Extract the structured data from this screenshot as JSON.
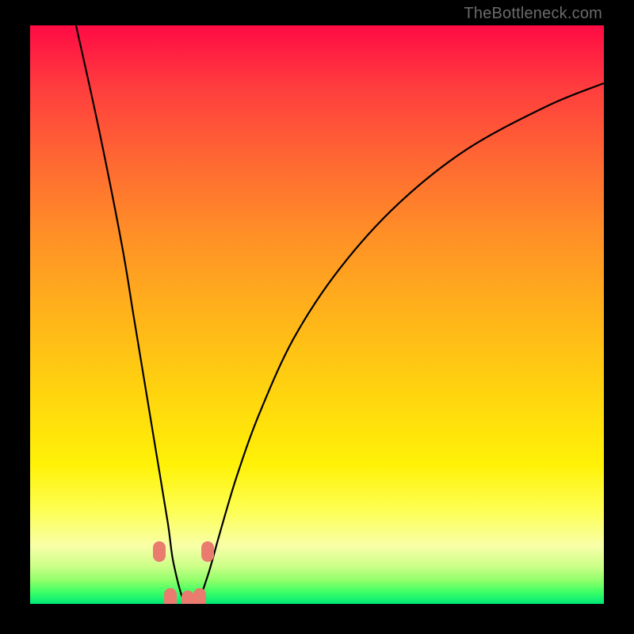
{
  "watermark": "TheBottleneck.com",
  "colors": {
    "frame": "#000000",
    "curve": "#000000",
    "marker": "#ea7c6f",
    "watermark": "#6a6a6a"
  },
  "chart_data": {
    "type": "line",
    "title": "",
    "xlabel": "",
    "ylabel": "",
    "xlim": [
      0,
      100
    ],
    "ylim": [
      0,
      100
    ],
    "grid": false,
    "legend": false,
    "notes": "Bottleneck-style curve: minimum (~0) near x≈27; rises steeply on both sides. Background is a vertical red→green gradient.",
    "series": [
      {
        "name": "bottleneck-curve",
        "x": [
          8,
          12,
          16,
          18,
          20,
          22,
          24,
          25,
          27,
          29,
          31,
          33,
          36,
          40,
          46,
          54,
          64,
          76,
          90,
          100
        ],
        "y": [
          100,
          82,
          62,
          50,
          38,
          26,
          14,
          7,
          0,
          0,
          5,
          12,
          22,
          33,
          46,
          58,
          69,
          78.5,
          86,
          90
        ]
      }
    ],
    "markers": [
      {
        "x": 22.5,
        "y": 9
      },
      {
        "x": 24.5,
        "y": 1
      },
      {
        "x": 27.5,
        "y": 0.5
      },
      {
        "x": 29.5,
        "y": 1
      },
      {
        "x": 31.0,
        "y": 9
      }
    ]
  }
}
